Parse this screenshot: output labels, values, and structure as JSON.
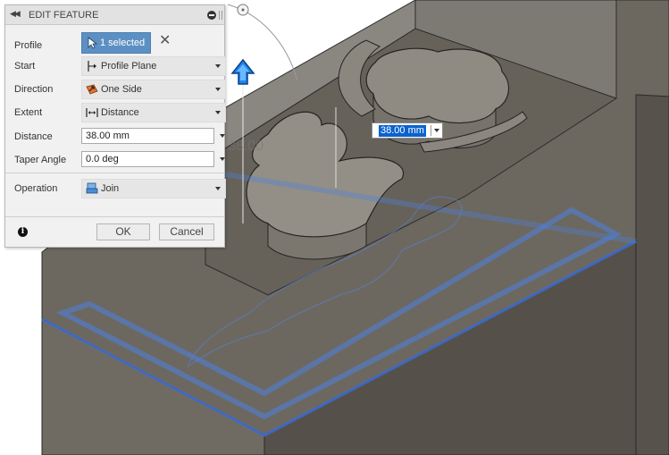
{
  "dialog": {
    "title": "EDIT FEATURE",
    "profile": {
      "label": "Profile",
      "value": "1 selected"
    },
    "start": {
      "label": "Start",
      "value": "Profile Plane"
    },
    "direction": {
      "label": "Direction",
      "value": "One Side"
    },
    "extent": {
      "label": "Extent",
      "value": "Distance"
    },
    "distance": {
      "label": "Distance",
      "value": "38.00 mm"
    },
    "taper_angle": {
      "label": "Taper Angle",
      "value": "0.0 deg"
    },
    "operation": {
      "label": "Operation",
      "value": "Join"
    },
    "ok_label": "OK",
    "cancel_label": "Cancel",
    "info_glyph": "i"
  },
  "viewport": {
    "dimension_label": "38.00",
    "distance_input_value": "38.00 mm"
  },
  "icons": {
    "collapse": "double-left-arrow-icon",
    "close": "close-icon",
    "cursor": "cursor-arrow-icon",
    "clear": "x-icon",
    "profile_plane": "profile-plane-icon",
    "one_side": "one-side-icon",
    "distance": "distance-icon",
    "join": "join-icon",
    "info": "info-icon",
    "manipulator": "blue-up-arrow-icon"
  },
  "colors": {
    "accent_selected": "#5d90c2",
    "text_selection": "#0a62cf",
    "body_face": "#5e5a53",
    "selected_edge": "#3d6fd8",
    "manipulator": "#1e86e8"
  }
}
